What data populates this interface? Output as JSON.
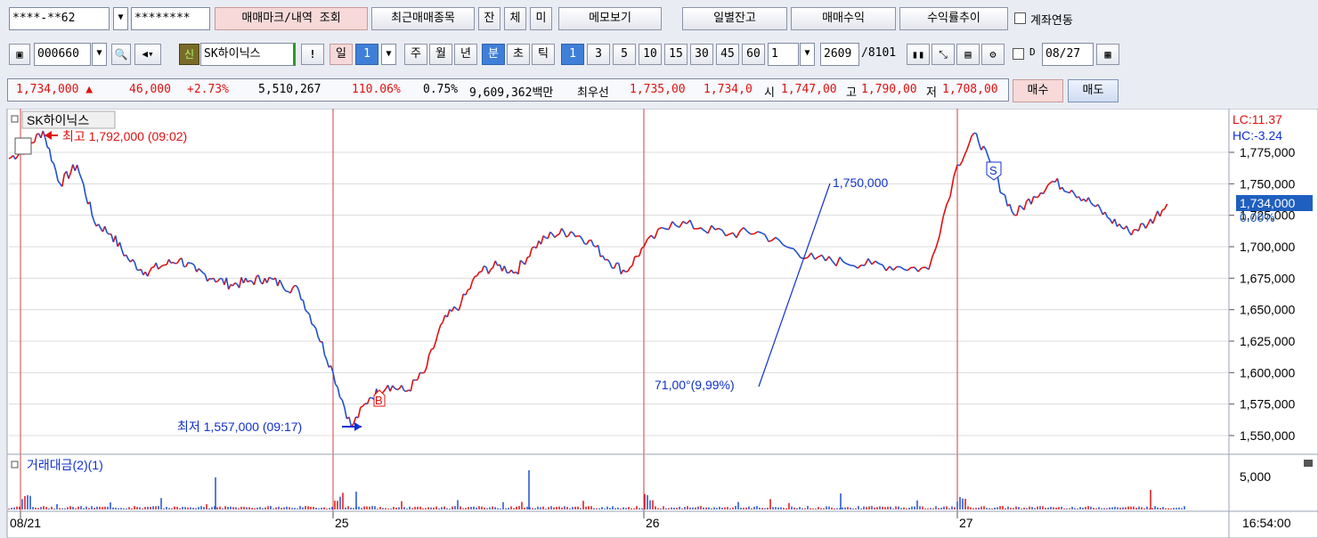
{
  "toolbar1": {
    "account_masked": "****-**62",
    "password_masked": "********",
    "trade_mark_btn": "매매마크/내역 조회",
    "recent_items_btn": "최근매매종목",
    "tab_jan": "잔",
    "tab_che": "체",
    "tab_mi": "미",
    "memo_btn": "메모보기",
    "daily_balance_btn": "일별잔고",
    "trade_profit_btn": "매매수익",
    "return_trend_btn": "수익률추이",
    "account_link_label": "계좌연동"
  },
  "toolbar2": {
    "stock_code": "000660",
    "credit_badge": "신",
    "stock_name": "SK하이닉스",
    "alert_label": "!",
    "period_day": "일",
    "period_value": "1",
    "period_week": "주",
    "period_month": "월",
    "period_year": "년",
    "period_minute": "분",
    "period_second": "초",
    "period_tick": "틱",
    "intervals": [
      "1",
      "3",
      "5",
      "10",
      "15",
      "30",
      "45",
      "60"
    ],
    "interval_input": "1",
    "count_value": "2609",
    "count_total": "/8101",
    "d_label": "D",
    "date_value": "08/27"
  },
  "quote": {
    "price": "1,734,000",
    "change": "46,000",
    "change_pct": "+2.73%",
    "volume": "5,510,267",
    "volume_ratio": "110.06%",
    "turnover": "0.75%",
    "amount": "9,609,362백만",
    "best_label": "최우선",
    "best_ask": "1,735,00",
    "best_bid": "1,734,0",
    "open_label": "시",
    "open": "1,747,00",
    "high_label": "고",
    "high": "1,790,00",
    "low_label": "저",
    "low": "1,708,00",
    "buy_btn": "매수",
    "sell_btn": "매도"
  },
  "chart": {
    "title": "SK하이닉스",
    "lc": "LC:11.37",
    "hc": "HC:-3.24",
    "current_price": "1,734,000",
    "current_pct": "0.00%",
    "high_annot": "최고 1,792,000 (09:02)",
    "low_annot": "최저 1,557,000 (09:17)",
    "trend_top": "1,750,000",
    "trend_bottom": "71,00°(9,99%)",
    "buy_marker": "B",
    "sell_marker": "S",
    "volume_title": "거래대금(2)(1)",
    "volume_axis": "5,000",
    "x_labels": [
      "08/21",
      "25",
      "26",
      "27"
    ],
    "time": "16:54:00"
  },
  "chart_data": {
    "type": "line",
    "title": "SK하이닉스",
    "y_ticks": [
      1775000,
      1750000,
      1725000,
      1700000,
      1675000,
      1650000,
      1625000,
      1600000,
      1575000,
      1550000
    ],
    "y_tick_labels": [
      "1,775,000",
      "1,750,000",
      "1,725,000",
      "1,700,000",
      "1,675,000",
      "1,650,000",
      "1,625,000",
      "1,600,000",
      "1,575,000",
      "1,550,000"
    ],
    "ylim": [
      1540000,
      1800000
    ],
    "sessions": [
      "08/21",
      "25",
      "26",
      "27"
    ],
    "series": [
      {
        "name": "",
        "values": [
          1770000,
          1778000,
          1792000,
          1750000,
          1765000,
          1720000,
          1710000,
          1690000,
          1680000,
          1685000,
          1690000,
          1680000,
          1675000,
          1670000,
          1672000,
          1675000,
          1670000,
          1665000,
          1635000,
          1600000,
          1557000,
          1580000,
          1590000,
          1585000,
          1600000,
          1640000,
          1655000,
          1680000,
          1685000,
          1680000,
          1700000,
          1710000,
          1712000,
          1705000,
          1690000,
          1680000,
          1700000,
          1720000,
          1715000,
          1710000,
          1712000,
          1700000,
          1690000,
          1688000,
          1686000,
          1684000,
          1682000,
          1765000,
          1790000,
          1755000,
          1725000,
          1740000,
          1752000,
          1745000,
          1735000,
          1722000,
          1712000,
          1718000,
          1734000
        ]
      }
    ]
  }
}
